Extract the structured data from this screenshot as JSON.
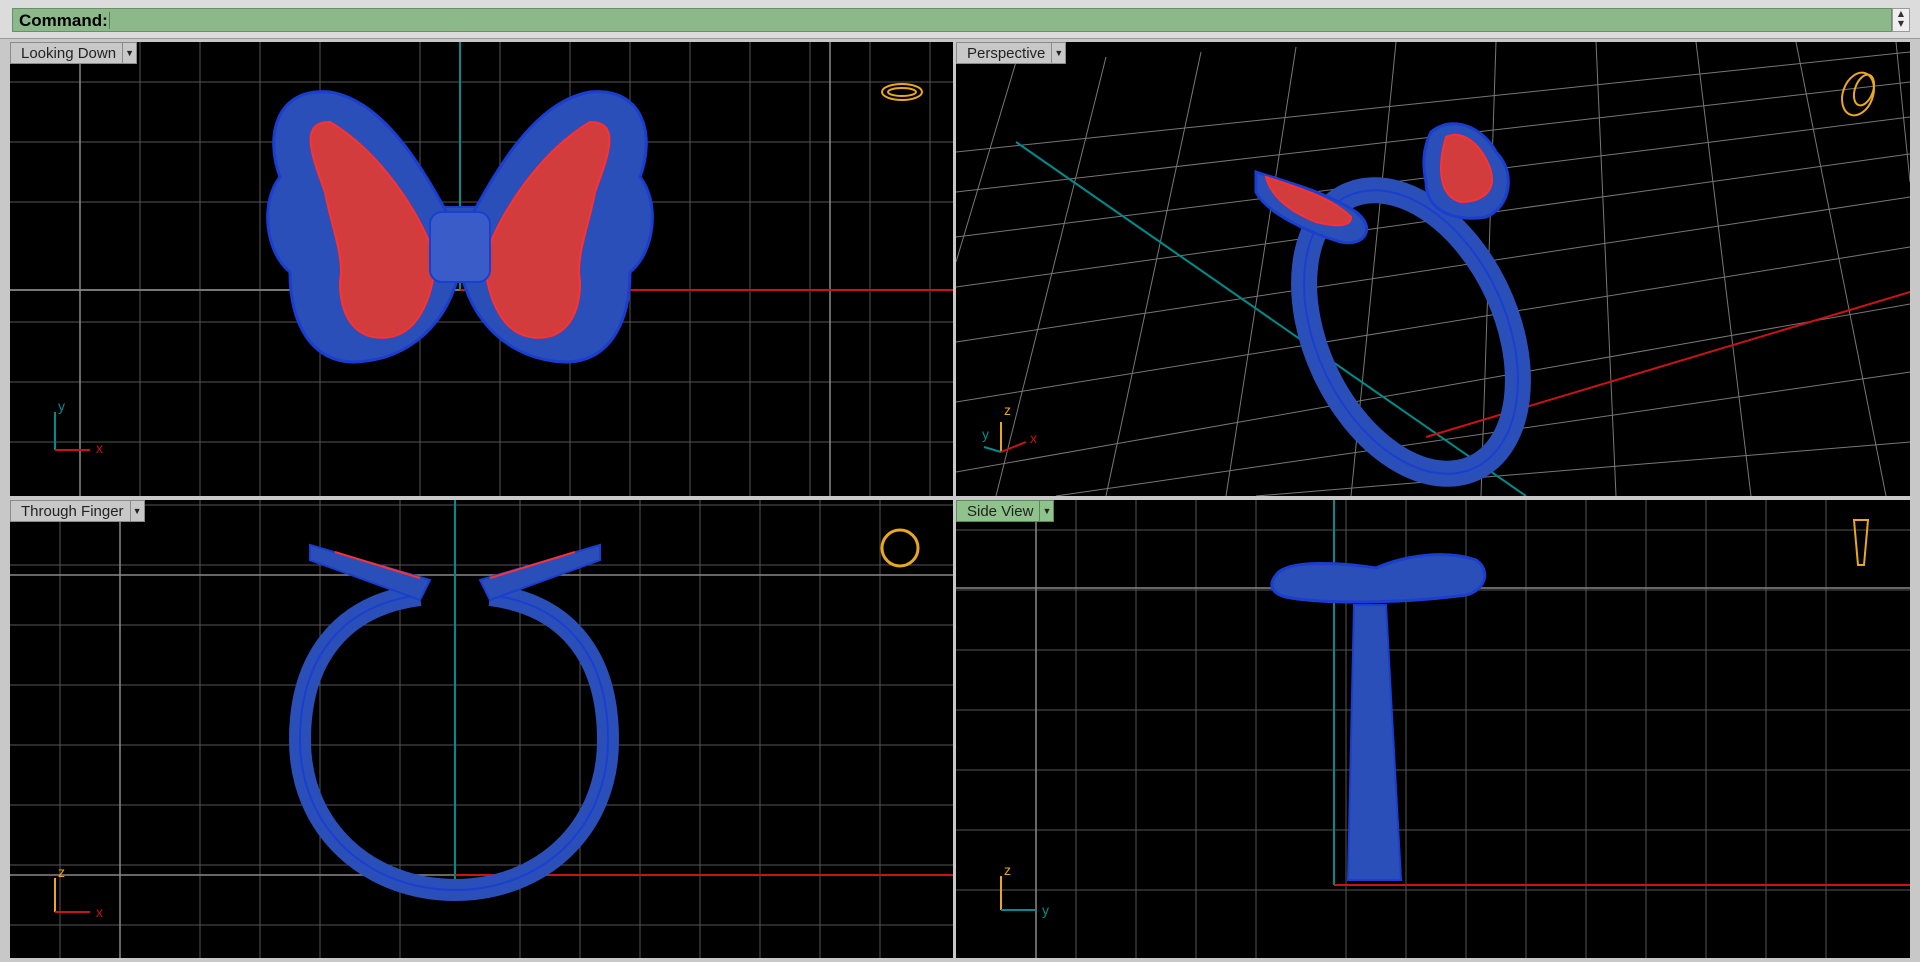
{
  "command": {
    "label": "Command:",
    "value": ""
  },
  "viewports": [
    {
      "title": "Looking Down",
      "axes": [
        "y",
        "x"
      ],
      "active": false
    },
    {
      "title": "Perspective",
      "axes": [
        "z",
        "y",
        "x"
      ],
      "active": false
    },
    {
      "title": "Through Finger",
      "axes": [
        "z",
        "x"
      ],
      "active": false
    },
    {
      "title": "Side View",
      "axes": [
        "z",
        "y"
      ],
      "active": true
    }
  ],
  "colors": {
    "grid": "#5a5a5a",
    "x_axis": "#c81414",
    "y_axis": "#008c8c",
    "model": "#2b4fb8",
    "model_edge": "#1a3fd0",
    "wing": "#d23c3c",
    "active_tab": "#8fc28c",
    "command_bar": "#8cb98a",
    "gizmo": "#e8a820"
  }
}
